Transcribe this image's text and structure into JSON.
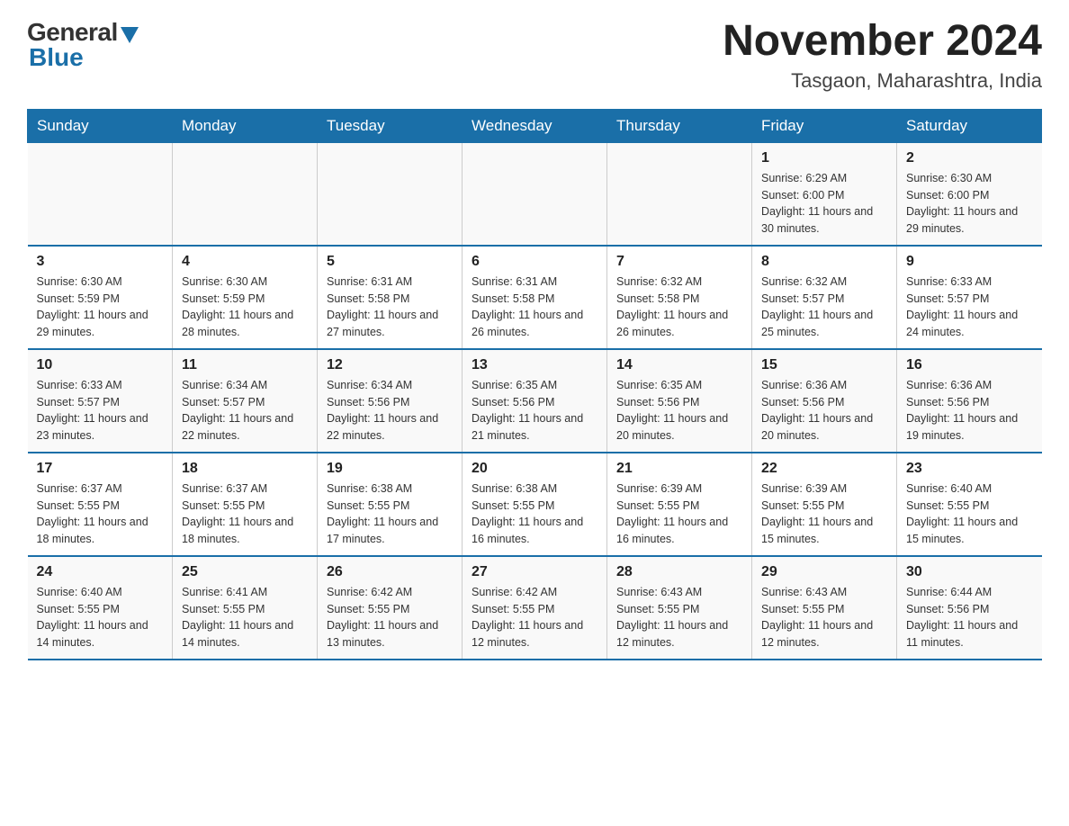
{
  "header": {
    "logo_general": "General",
    "logo_blue": "Blue",
    "month_title": "November 2024",
    "location": "Tasgaon, Maharashtra, India"
  },
  "days_of_week": [
    "Sunday",
    "Monday",
    "Tuesday",
    "Wednesday",
    "Thursday",
    "Friday",
    "Saturday"
  ],
  "weeks": [
    [
      {
        "day": "",
        "sunrise": "",
        "sunset": "",
        "daylight": ""
      },
      {
        "day": "",
        "sunrise": "",
        "sunset": "",
        "daylight": ""
      },
      {
        "day": "",
        "sunrise": "",
        "sunset": "",
        "daylight": ""
      },
      {
        "day": "",
        "sunrise": "",
        "sunset": "",
        "daylight": ""
      },
      {
        "day": "",
        "sunrise": "",
        "sunset": "",
        "daylight": ""
      },
      {
        "day": "1",
        "sunrise": "Sunrise: 6:29 AM",
        "sunset": "Sunset: 6:00 PM",
        "daylight": "Daylight: 11 hours and 30 minutes."
      },
      {
        "day": "2",
        "sunrise": "Sunrise: 6:30 AM",
        "sunset": "Sunset: 6:00 PM",
        "daylight": "Daylight: 11 hours and 29 minutes."
      }
    ],
    [
      {
        "day": "3",
        "sunrise": "Sunrise: 6:30 AM",
        "sunset": "Sunset: 5:59 PM",
        "daylight": "Daylight: 11 hours and 29 minutes."
      },
      {
        "day": "4",
        "sunrise": "Sunrise: 6:30 AM",
        "sunset": "Sunset: 5:59 PM",
        "daylight": "Daylight: 11 hours and 28 minutes."
      },
      {
        "day": "5",
        "sunrise": "Sunrise: 6:31 AM",
        "sunset": "Sunset: 5:58 PM",
        "daylight": "Daylight: 11 hours and 27 minutes."
      },
      {
        "day": "6",
        "sunrise": "Sunrise: 6:31 AM",
        "sunset": "Sunset: 5:58 PM",
        "daylight": "Daylight: 11 hours and 26 minutes."
      },
      {
        "day": "7",
        "sunrise": "Sunrise: 6:32 AM",
        "sunset": "Sunset: 5:58 PM",
        "daylight": "Daylight: 11 hours and 26 minutes."
      },
      {
        "day": "8",
        "sunrise": "Sunrise: 6:32 AM",
        "sunset": "Sunset: 5:57 PM",
        "daylight": "Daylight: 11 hours and 25 minutes."
      },
      {
        "day": "9",
        "sunrise": "Sunrise: 6:33 AM",
        "sunset": "Sunset: 5:57 PM",
        "daylight": "Daylight: 11 hours and 24 minutes."
      }
    ],
    [
      {
        "day": "10",
        "sunrise": "Sunrise: 6:33 AM",
        "sunset": "Sunset: 5:57 PM",
        "daylight": "Daylight: 11 hours and 23 minutes."
      },
      {
        "day": "11",
        "sunrise": "Sunrise: 6:34 AM",
        "sunset": "Sunset: 5:57 PM",
        "daylight": "Daylight: 11 hours and 22 minutes."
      },
      {
        "day": "12",
        "sunrise": "Sunrise: 6:34 AM",
        "sunset": "Sunset: 5:56 PM",
        "daylight": "Daylight: 11 hours and 22 minutes."
      },
      {
        "day": "13",
        "sunrise": "Sunrise: 6:35 AM",
        "sunset": "Sunset: 5:56 PM",
        "daylight": "Daylight: 11 hours and 21 minutes."
      },
      {
        "day": "14",
        "sunrise": "Sunrise: 6:35 AM",
        "sunset": "Sunset: 5:56 PM",
        "daylight": "Daylight: 11 hours and 20 minutes."
      },
      {
        "day": "15",
        "sunrise": "Sunrise: 6:36 AM",
        "sunset": "Sunset: 5:56 PM",
        "daylight": "Daylight: 11 hours and 20 minutes."
      },
      {
        "day": "16",
        "sunrise": "Sunrise: 6:36 AM",
        "sunset": "Sunset: 5:56 PM",
        "daylight": "Daylight: 11 hours and 19 minutes."
      }
    ],
    [
      {
        "day": "17",
        "sunrise": "Sunrise: 6:37 AM",
        "sunset": "Sunset: 5:55 PM",
        "daylight": "Daylight: 11 hours and 18 minutes."
      },
      {
        "day": "18",
        "sunrise": "Sunrise: 6:37 AM",
        "sunset": "Sunset: 5:55 PM",
        "daylight": "Daylight: 11 hours and 18 minutes."
      },
      {
        "day": "19",
        "sunrise": "Sunrise: 6:38 AM",
        "sunset": "Sunset: 5:55 PM",
        "daylight": "Daylight: 11 hours and 17 minutes."
      },
      {
        "day": "20",
        "sunrise": "Sunrise: 6:38 AM",
        "sunset": "Sunset: 5:55 PM",
        "daylight": "Daylight: 11 hours and 16 minutes."
      },
      {
        "day": "21",
        "sunrise": "Sunrise: 6:39 AM",
        "sunset": "Sunset: 5:55 PM",
        "daylight": "Daylight: 11 hours and 16 minutes."
      },
      {
        "day": "22",
        "sunrise": "Sunrise: 6:39 AM",
        "sunset": "Sunset: 5:55 PM",
        "daylight": "Daylight: 11 hours and 15 minutes."
      },
      {
        "day": "23",
        "sunrise": "Sunrise: 6:40 AM",
        "sunset": "Sunset: 5:55 PM",
        "daylight": "Daylight: 11 hours and 15 minutes."
      }
    ],
    [
      {
        "day": "24",
        "sunrise": "Sunrise: 6:40 AM",
        "sunset": "Sunset: 5:55 PM",
        "daylight": "Daylight: 11 hours and 14 minutes."
      },
      {
        "day": "25",
        "sunrise": "Sunrise: 6:41 AM",
        "sunset": "Sunset: 5:55 PM",
        "daylight": "Daylight: 11 hours and 14 minutes."
      },
      {
        "day": "26",
        "sunrise": "Sunrise: 6:42 AM",
        "sunset": "Sunset: 5:55 PM",
        "daylight": "Daylight: 11 hours and 13 minutes."
      },
      {
        "day": "27",
        "sunrise": "Sunrise: 6:42 AM",
        "sunset": "Sunset: 5:55 PM",
        "daylight": "Daylight: 11 hours and 12 minutes."
      },
      {
        "day": "28",
        "sunrise": "Sunrise: 6:43 AM",
        "sunset": "Sunset: 5:55 PM",
        "daylight": "Daylight: 11 hours and 12 minutes."
      },
      {
        "day": "29",
        "sunrise": "Sunrise: 6:43 AM",
        "sunset": "Sunset: 5:55 PM",
        "daylight": "Daylight: 11 hours and 12 minutes."
      },
      {
        "day": "30",
        "sunrise": "Sunrise: 6:44 AM",
        "sunset": "Sunset: 5:56 PM",
        "daylight": "Daylight: 11 hours and 11 minutes."
      }
    ]
  ]
}
